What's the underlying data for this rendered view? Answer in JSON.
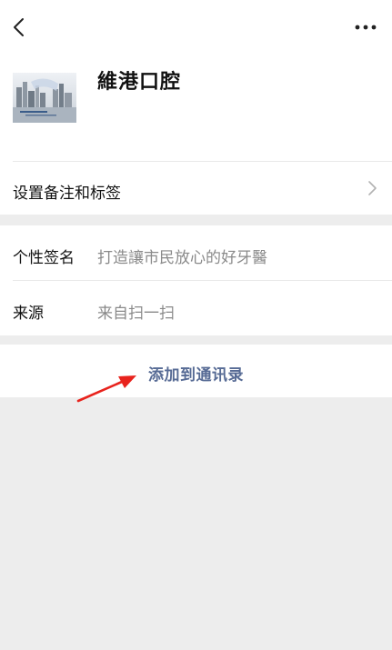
{
  "contact": {
    "name": "維港口腔",
    "avatar_text_line1": "維港口腔",
    "avatar_text_line2": "打造讓市民放心的好牙醫"
  },
  "rows": {
    "remark_label": "设置备注和标签",
    "signature_label": "个性签名",
    "signature_value": "打造讓市民放心的好牙醫",
    "source_label": "来源",
    "source_value": "来自扫一扫"
  },
  "actions": {
    "add_contact_label": "添加到通讯录"
  },
  "icons": {
    "back": "chevron-left-icon",
    "more": "more-dots-icon",
    "row_chevron": "chevron-right-icon",
    "annotation_arrow": "red-arrow-icon"
  },
  "colors": {
    "link_blue": "#576b95",
    "annotation_red": "#e8231d",
    "background_gray": "#ededed"
  }
}
